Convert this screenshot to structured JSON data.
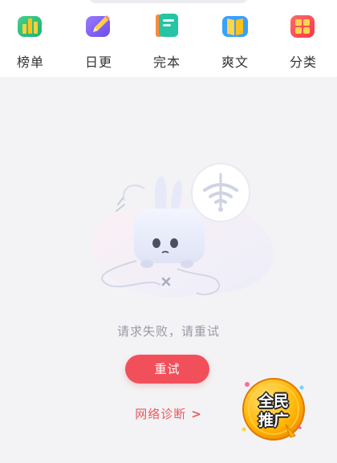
{
  "nav": {
    "items": [
      {
        "label": "榜单",
        "icon": "bar-chart-icon"
      },
      {
        "label": "日更",
        "icon": "pen-icon"
      },
      {
        "label": "完本",
        "icon": "book-icon"
      },
      {
        "label": "爽文",
        "icon": "open-book-icon"
      },
      {
        "label": "分类",
        "icon": "grid-icon"
      }
    ]
  },
  "error": {
    "message": "请求失败，请重试",
    "retry_label": "重试",
    "diagnose_label": "网络诊断",
    "diagnose_chevron": ">"
  },
  "promo": {
    "line1": "全民",
    "line2": "推广"
  },
  "colors": {
    "accent": "#f1505a",
    "link": "#e85a5e",
    "message": "#9a9aa4",
    "background": "#f3f3f5"
  }
}
